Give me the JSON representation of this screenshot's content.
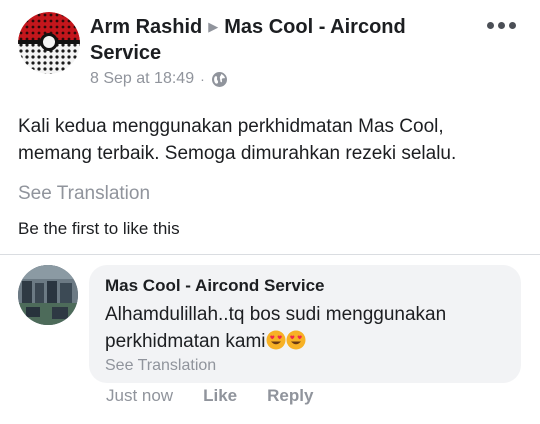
{
  "post": {
    "author": "Arm Rashid",
    "target_page": "Mas Cool - Aircond Service",
    "timestamp": "8 Sep at 18:49",
    "separator": "·",
    "privacy_icon": "globe-icon",
    "more_icon": "more-horizontal-icon",
    "text": "Kali kedua menggunakan perkhidmatan Mas Cool, memang terbaik. Semoga dimurahkan rezeki selalu.",
    "see_translation": "See Translation",
    "likes_text": "Be the first to like this"
  },
  "comment": {
    "author": "Mas Cool - Aircond Service",
    "text": "Alhamdulillah..tq bos sudi menggunakan perkhidmatan kami",
    "emoji_icon": "heart-eyes-emoji-icon",
    "see_translation": "See Translation",
    "time": "Just now",
    "like_label": "Like",
    "reply_label": "Reply"
  },
  "colors": {
    "text": "#1c1e21",
    "muted": "#90949c",
    "bubble": "#f2f3f5",
    "emoji": "#f7b125",
    "heart": "#f0284a"
  }
}
